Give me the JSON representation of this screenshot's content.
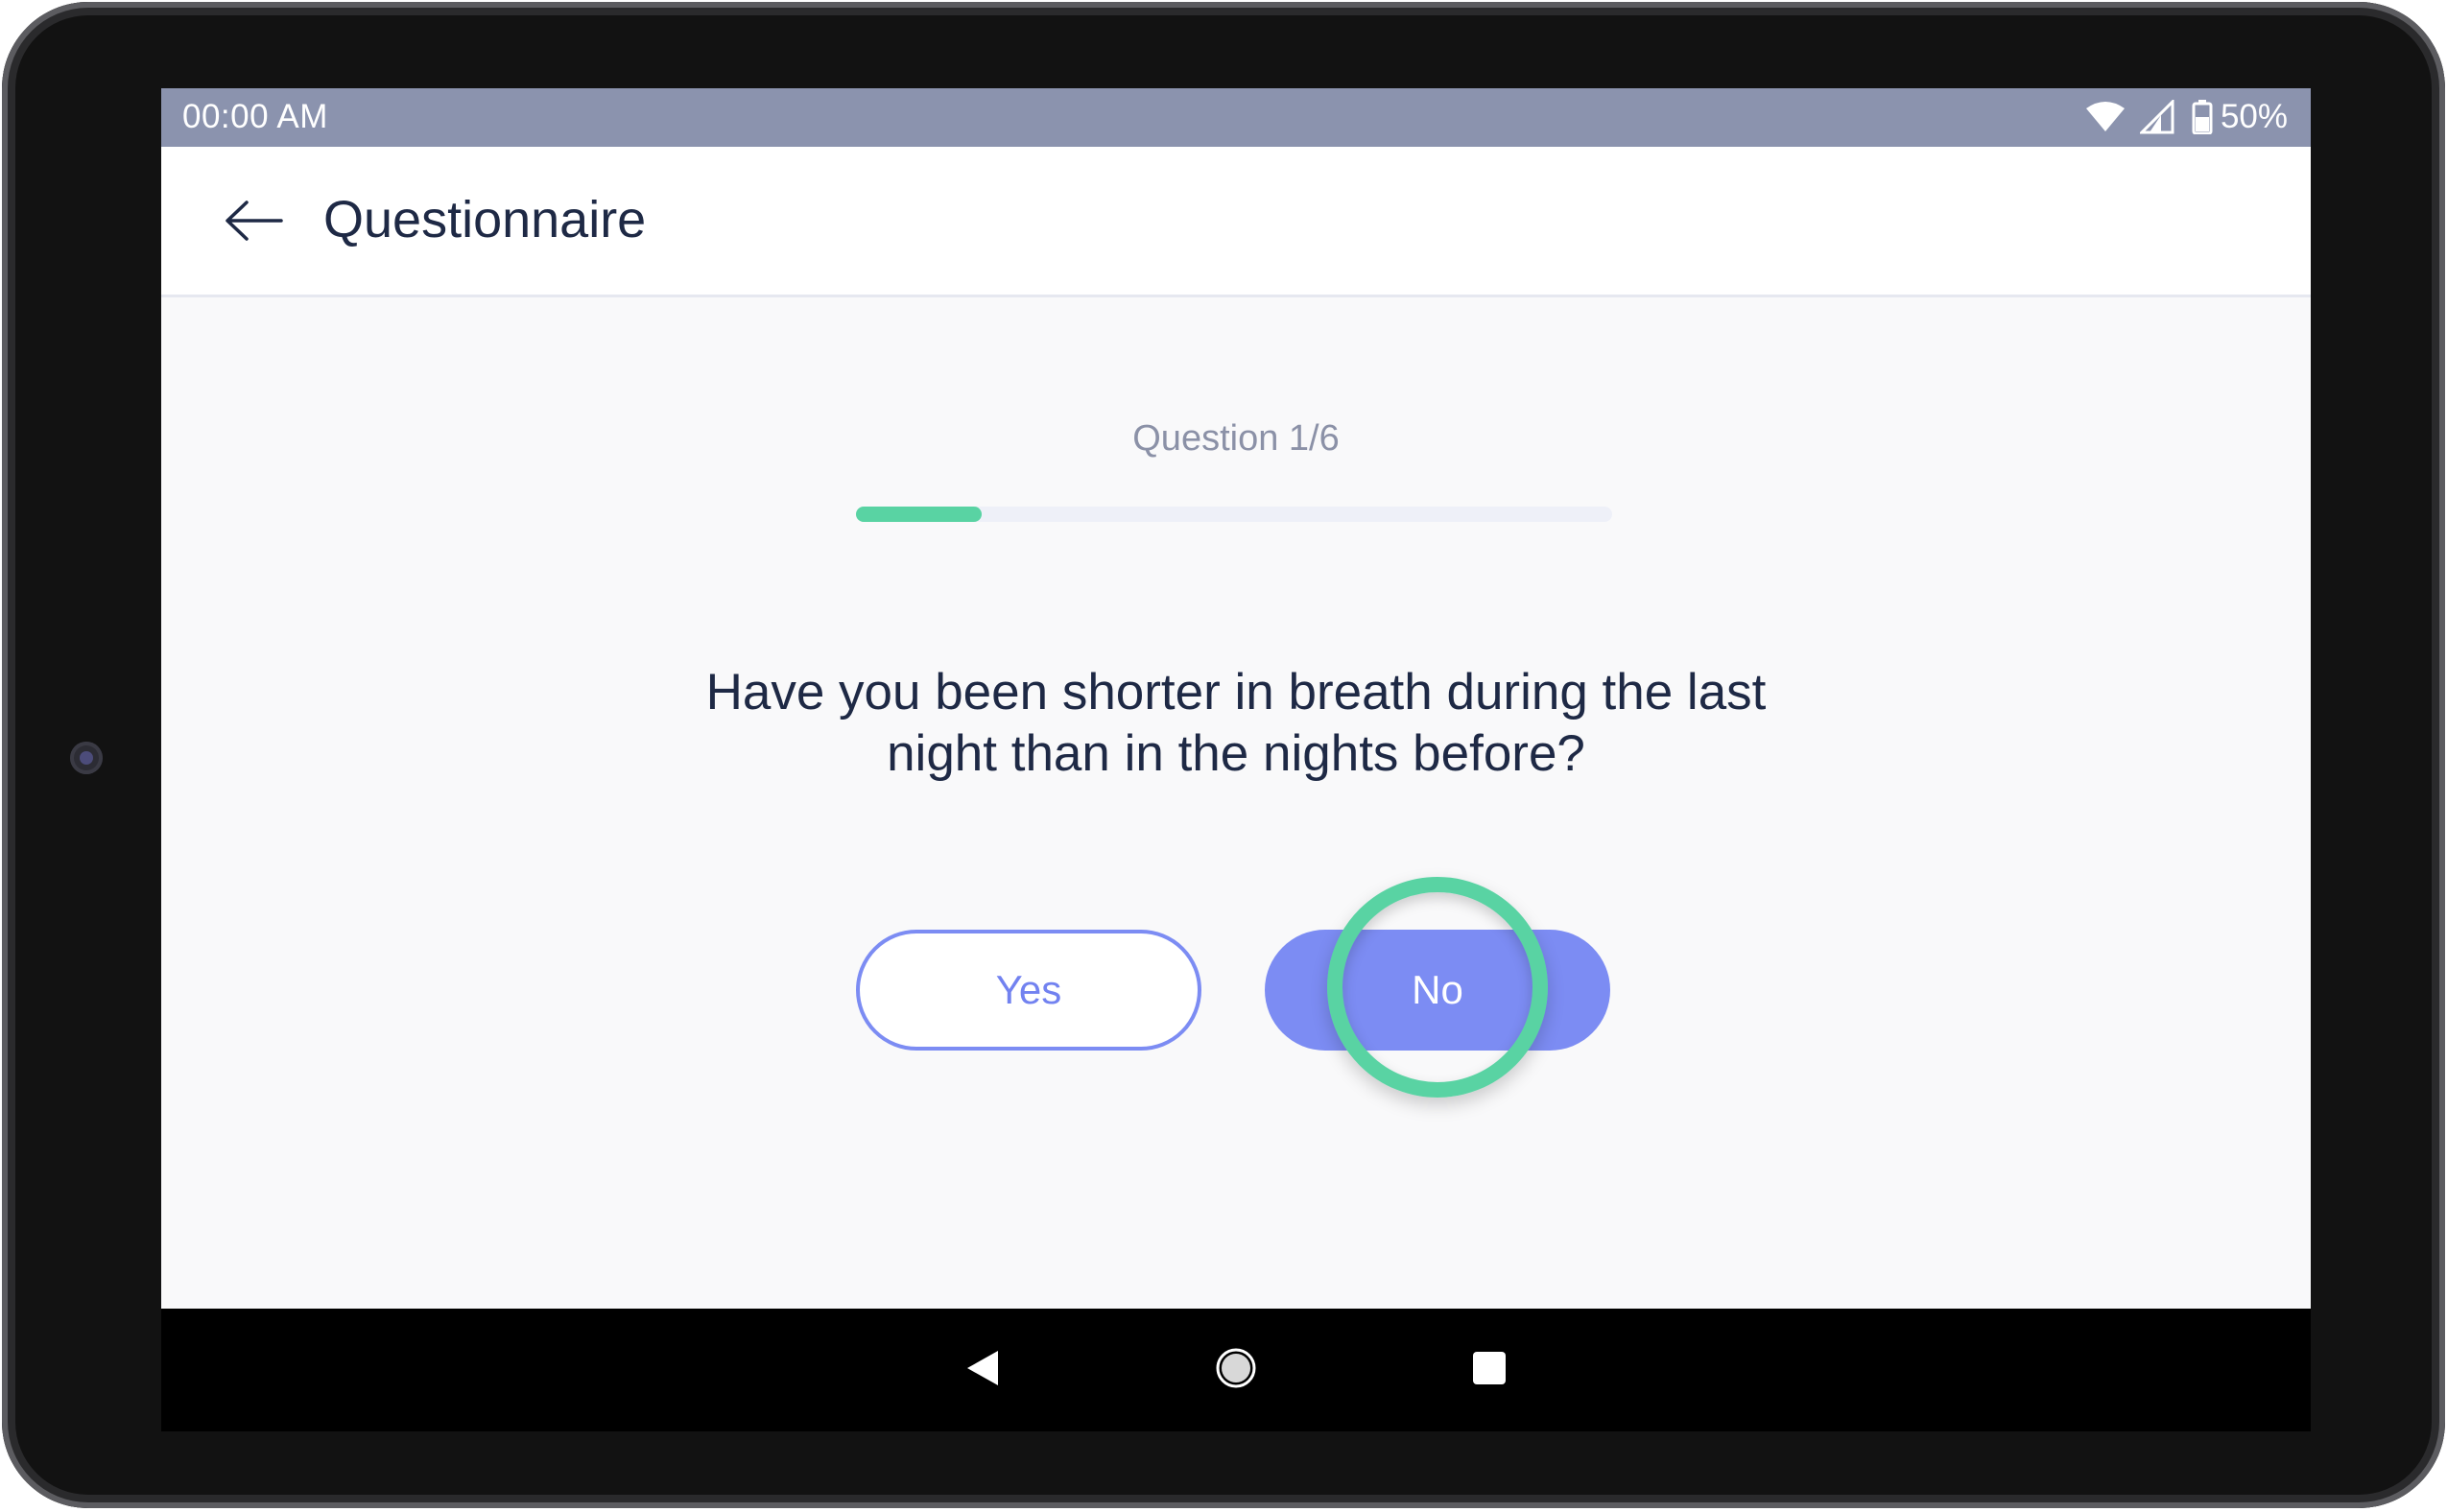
{
  "status_bar": {
    "time": "00:00 AM",
    "battery": "50%",
    "icons": [
      "wifi-icon",
      "signal-icon",
      "battery-icon"
    ]
  },
  "app_bar": {
    "back_icon": "arrow-left-icon",
    "title": "Questionnaire"
  },
  "questionnaire": {
    "counter": "Question 1/6",
    "progress_fraction": 0.1667,
    "question": "Have you been shorter in breath during the last night than in the nights before?",
    "answers": {
      "yes": "Yes",
      "no": "No"
    }
  },
  "nav_bar": {
    "icons": [
      "back-triangle-icon",
      "home-circle-icon",
      "recents-square-icon"
    ]
  },
  "colors": {
    "status_bar": "#8b93ae",
    "accent": "#7c8cf3",
    "progress": "#59d3a3",
    "tap_indicator": "#59d3a3",
    "title_text": "#1e2945"
  }
}
